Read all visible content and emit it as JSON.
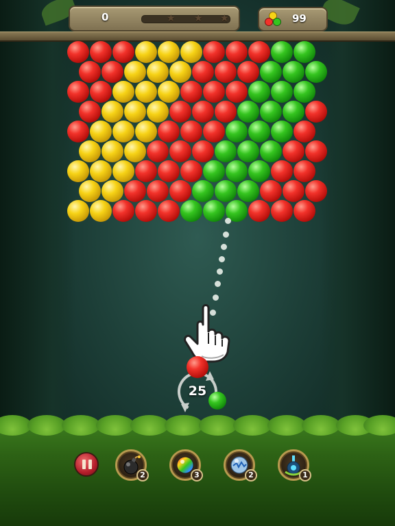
{
  "hud": {
    "score": "0",
    "stars_earned": 0,
    "stars_total": 3,
    "progress": 0,
    "coins": "99"
  },
  "board": {
    "rows": [
      [
        "R",
        "R",
        "R",
        "Y",
        "Y",
        "Y",
        "R",
        "R",
        "R",
        "G",
        "G"
      ],
      [
        "R",
        "R",
        "Y",
        "Y",
        "Y",
        "R",
        "R",
        "R",
        "G",
        "G",
        "G"
      ],
      [
        "R",
        "R",
        "Y",
        "Y",
        "Y",
        "R",
        "R",
        "R",
        "G",
        "G",
        "G"
      ],
      [
        "R",
        "Y",
        "Y",
        "Y",
        "R",
        "R",
        "R",
        "G",
        "G",
        "G",
        "R"
      ],
      [
        "R",
        "Y",
        "Y",
        "Y",
        "R",
        "R",
        "R",
        "G",
        "G",
        "G",
        "R"
      ],
      [
        "Y",
        "Y",
        "Y",
        "R",
        "R",
        "R",
        "G",
        "G",
        "G",
        "R",
        "R"
      ],
      [
        "Y",
        "Y",
        "Y",
        "R",
        "R",
        "R",
        "G",
        "G",
        "G",
        "R",
        "R"
      ],
      [
        "Y",
        "Y",
        "R",
        "R",
        "R",
        "G",
        "G",
        "G",
        "R",
        "R",
        "R"
      ],
      [
        "Y",
        "Y",
        "R",
        "R",
        "R",
        "G",
        "G",
        "G",
        "R",
        "R",
        "R"
      ]
    ],
    "colors": {
      "R": "red",
      "Y": "yellow",
      "G": "green"
    }
  },
  "shooter": {
    "shots_left": "25",
    "current_bubble": "red",
    "next_bubble": "green"
  },
  "tutorial": {
    "hint_icon": "pointing-hand-icon"
  },
  "boosters": [
    {
      "name": "bomb",
      "icon": "bomb-icon",
      "count": "2"
    },
    {
      "name": "rainbow",
      "icon": "rainbow-ball-icon",
      "count": "3"
    },
    {
      "name": "lightning",
      "icon": "lightning-ball-icon",
      "count": "2"
    },
    {
      "name": "aim",
      "icon": "aim-laser-icon",
      "count": "1"
    }
  ],
  "controls": {
    "pause_icon": "pause-icon"
  }
}
